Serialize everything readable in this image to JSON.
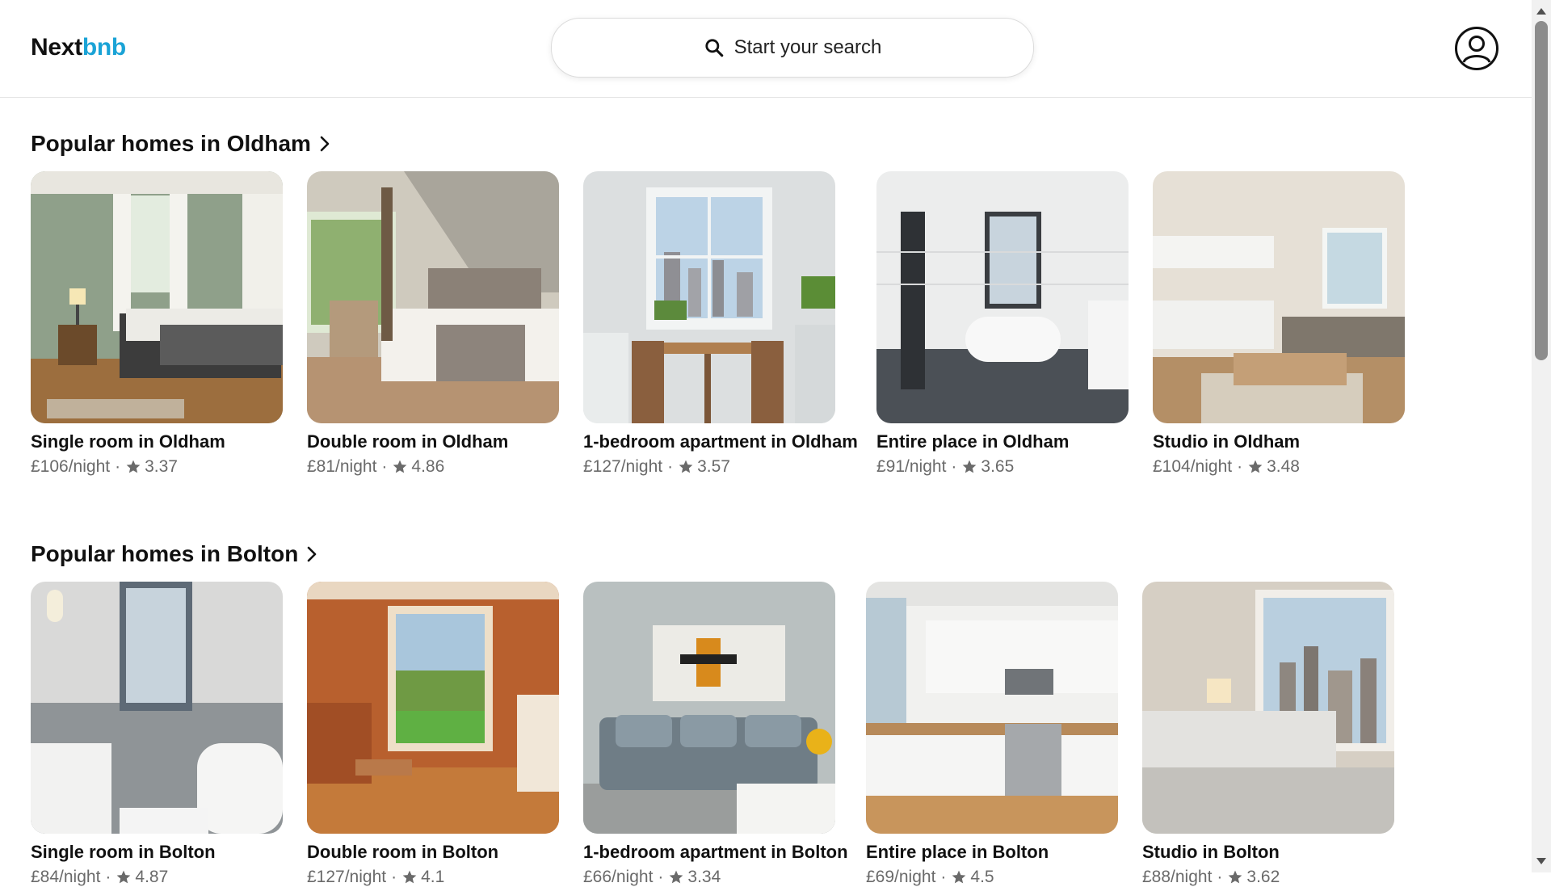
{
  "header": {
    "logo_main": "Next",
    "logo_accent": "bnb",
    "search_label": "Start your search"
  },
  "sections": [
    {
      "title": "Popular homes in Oldham",
      "listings": [
        {
          "title": "Single room in Oldham",
          "price": "£106/night",
          "rating": "3.37",
          "image": "bedroom-green-walls"
        },
        {
          "title": "Double room in Oldham",
          "price": "£81/night",
          "rating": "4.86",
          "image": "attic-bedroom"
        },
        {
          "title": "1-bedroom apartment in Oldham",
          "price": "£127/night",
          "rating": "3.57",
          "image": "dining-nook-city-window"
        },
        {
          "title": "Entire place in Oldham",
          "price": "£91/night",
          "rating": "3.65",
          "image": "white-tiled-bathroom"
        },
        {
          "title": "Studio in Oldham",
          "price": "£104/night",
          "rating": "3.48",
          "image": "studio-kitchen-living"
        }
      ]
    },
    {
      "title": "Popular homes in Bolton",
      "listings": [
        {
          "title": "Single room in Bolton",
          "price": "£84/night",
          "rating": "4.87",
          "image": "grey-bathroom"
        },
        {
          "title": "Double room in Bolton",
          "price": "£127/night",
          "rating": "4.1",
          "image": "orange-room-garden-window"
        },
        {
          "title": "1-bedroom apartment in Bolton",
          "price": "£66/night",
          "rating": "3.34",
          "image": "grey-sofa-artwork"
        },
        {
          "title": "Entire place in Bolton",
          "price": "£69/night",
          "rating": "4.5",
          "image": "white-kitchen"
        },
        {
          "title": "Studio in Bolton",
          "price": "£88/night",
          "rating": "3.62",
          "image": "bedroom-city-view"
        }
      ]
    }
  ],
  "colors": {
    "accent": "#1aa3d6",
    "text": "#111111",
    "muted": "#6a6a6a"
  },
  "icons": {
    "search": "search-icon",
    "user": "user-avatar-icon",
    "chevron": "chevron-right-icon",
    "star": "star-icon"
  }
}
